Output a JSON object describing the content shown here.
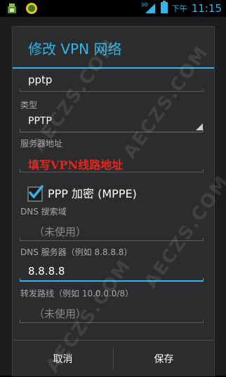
{
  "status_bar": {
    "ampm": "下午",
    "time": "11:15",
    "signal_label": "3G",
    "icons": [
      "app-icon",
      "status-smiley-icon",
      "signal-icon",
      "battery-icon"
    ]
  },
  "dialog": {
    "title": "修改 VPN 网络",
    "name_value": "pptp",
    "type_label": "类型",
    "type_value": "PPTP",
    "server_label": "服务器地址",
    "server_annotation": "填写VPN线路地址",
    "ppp_label": "PPP 加密 (MPPE)",
    "ppp_checked": true,
    "dns_search_label": "DNS 搜索域",
    "dns_search_placeholder": "（未使用）",
    "dns_server_label": "DNS 服务器（例如 8.8.8.8）",
    "dns_server_value": "8.8.8.8",
    "routes_label": "转发路线（例如 10.0.0.0/8）",
    "routes_placeholder": "（未使用）",
    "cancel_label": "取消",
    "save_label": "保存"
  },
  "watermark": "AECZS.COM",
  "colors": {
    "accent": "#33b5e5",
    "annotation": "#e8261f",
    "dialog_bg": "#2a2c2e"
  }
}
